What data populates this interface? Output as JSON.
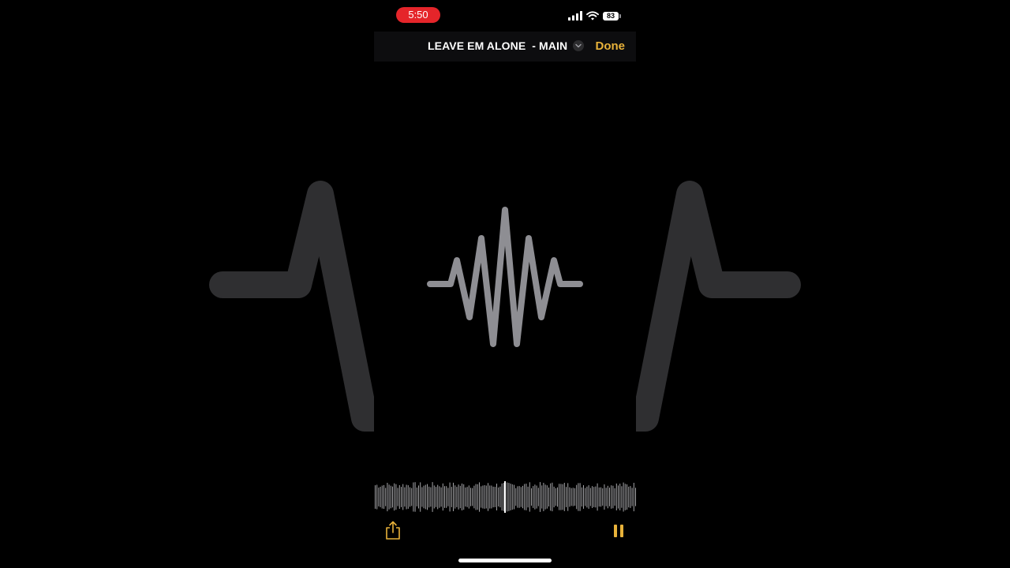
{
  "status_bar": {
    "time": "5:50",
    "battery_level": "83",
    "recording_indicator_color": "#e5252a"
  },
  "header": {
    "title": "LEAVE EM ALONE  - MAIN",
    "done_label": "Done",
    "accent_color": "#e8b23a"
  },
  "icons": {
    "dropdown": "chevron-down-icon",
    "share": "share-icon",
    "pause": "pause-icon",
    "waveform": "waveform-icon",
    "signal": "signal-icon",
    "wifi": "wifi-icon",
    "battery": "battery-icon"
  },
  "playback": {
    "state": "playing",
    "playhead_fraction": 0.5
  }
}
